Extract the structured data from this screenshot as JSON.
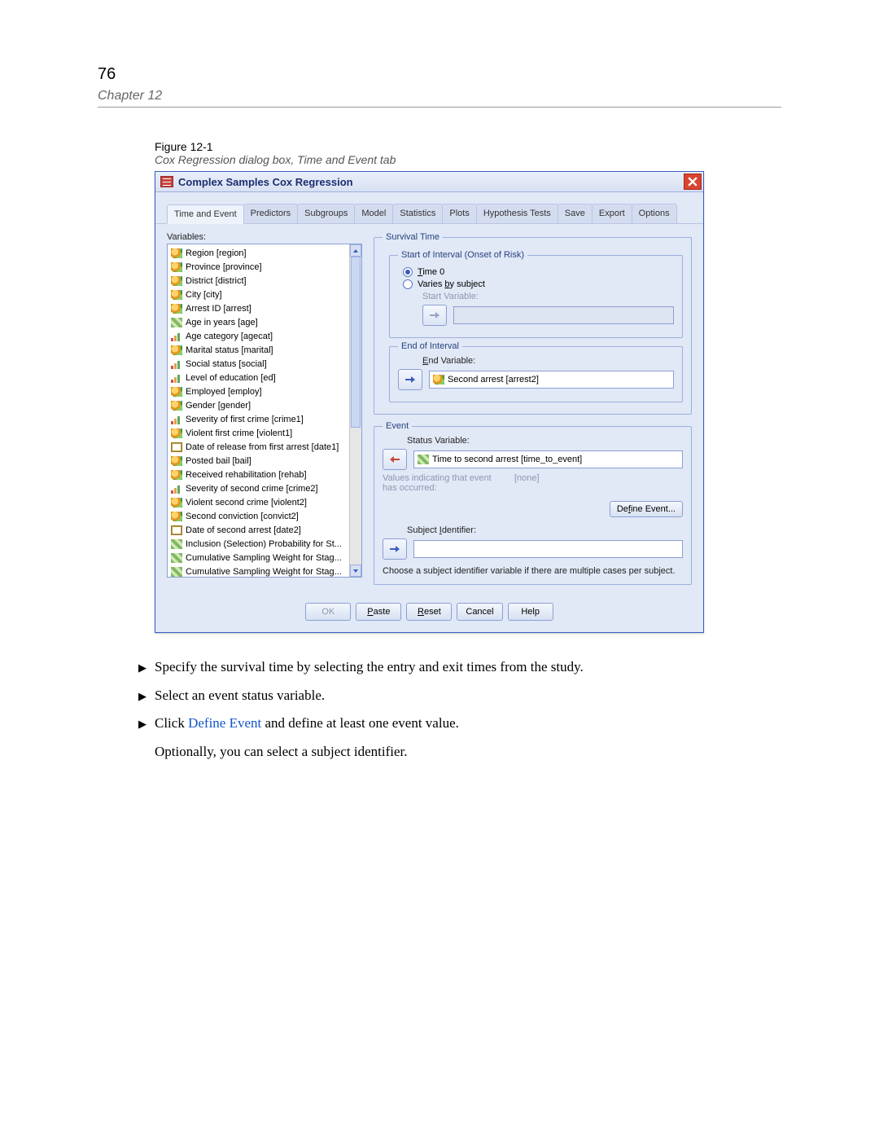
{
  "page_number": "76",
  "chapter": "Chapter 12",
  "figure_label": "Figure 12-1",
  "figure_caption": "Cox Regression dialog box, Time and Event tab",
  "dialog": {
    "title": "Complex Samples Cox Regression",
    "tabs": [
      "Time and Event",
      "Predictors",
      "Subgroups",
      "Model",
      "Statistics",
      "Plots",
      "Hypothesis Tests",
      "Save",
      "Export",
      "Options"
    ],
    "active_tab": 0,
    "vars_label": "Variables:",
    "variables": [
      {
        "t": "nom",
        "n": "Region [region]"
      },
      {
        "t": "nom",
        "n": "Province [province]"
      },
      {
        "t": "nom",
        "n": "District [district]"
      },
      {
        "t": "nom",
        "n": "City [city]"
      },
      {
        "t": "nom",
        "n": "Arrest ID [arrest]"
      },
      {
        "t": "sca",
        "n": "Age in years [age]"
      },
      {
        "t": "ord",
        "n": "Age category [agecat]"
      },
      {
        "t": "nom",
        "n": "Marital status [marital]"
      },
      {
        "t": "ord",
        "n": "Social status [social]"
      },
      {
        "t": "ord",
        "n": "Level of education [ed]"
      },
      {
        "t": "nom",
        "n": "Employed [employ]"
      },
      {
        "t": "nom",
        "n": "Gender [gender]"
      },
      {
        "t": "ord",
        "n": "Severity of first crime [crime1]"
      },
      {
        "t": "nom",
        "n": "Violent first crime [violent1]"
      },
      {
        "t": "dat",
        "n": "Date of release from first arrest [date1]"
      },
      {
        "t": "nom",
        "n": "Posted bail [bail]"
      },
      {
        "t": "nom",
        "n": "Received rehabilitation [rehab]"
      },
      {
        "t": "ord",
        "n": "Severity of second crime [crime2]"
      },
      {
        "t": "nom",
        "n": "Violent second crime [violent2]"
      },
      {
        "t": "nom",
        "n": "Second conviction [convict2]"
      },
      {
        "t": "dat",
        "n": "Date of second arrest [date2]"
      },
      {
        "t": "sca",
        "n": "Inclusion (Selection) Probability for St..."
      },
      {
        "t": "sca",
        "n": "Cumulative Sampling Weight for Stag..."
      },
      {
        "t": "sca",
        "n": "Cumulative Sampling Weight for Stag..."
      }
    ],
    "survival": {
      "legend": "Survival Time",
      "start_legend": "Start of Interval (Onset of Risk)",
      "radio_time0": "Time 0",
      "radio_varies": "Varies by subject",
      "start_label": "Start Variable:",
      "end_legend": "End of Interval",
      "end_label": "End Variable:",
      "end_var": "Second arrest [arrest2]"
    },
    "event": {
      "legend": "Event",
      "status_label": "Status Variable:",
      "status_var": "Time to second arrest [time_to_event]",
      "values_text": "Values indicating that event has occurred:",
      "values_value": "[none]",
      "define_btn": "Define Event...",
      "subj_label": "Subject Identifier:",
      "helptext": "Choose a subject identifier variable if there are multiple cases per subject."
    },
    "footer": {
      "ok": "OK",
      "paste": "Paste",
      "reset": "Reset",
      "cancel": "Cancel",
      "help": "Help"
    }
  },
  "body": {
    "step1": "Specify the survival time by selecting the entry and exit times from the study.",
    "step2": "Select an event status variable.",
    "step3_pre": "Click ",
    "step3_link": "Define Event",
    "step3_post": " and define at least one event value.",
    "opt": "Optionally, you can select a subject identifier."
  }
}
